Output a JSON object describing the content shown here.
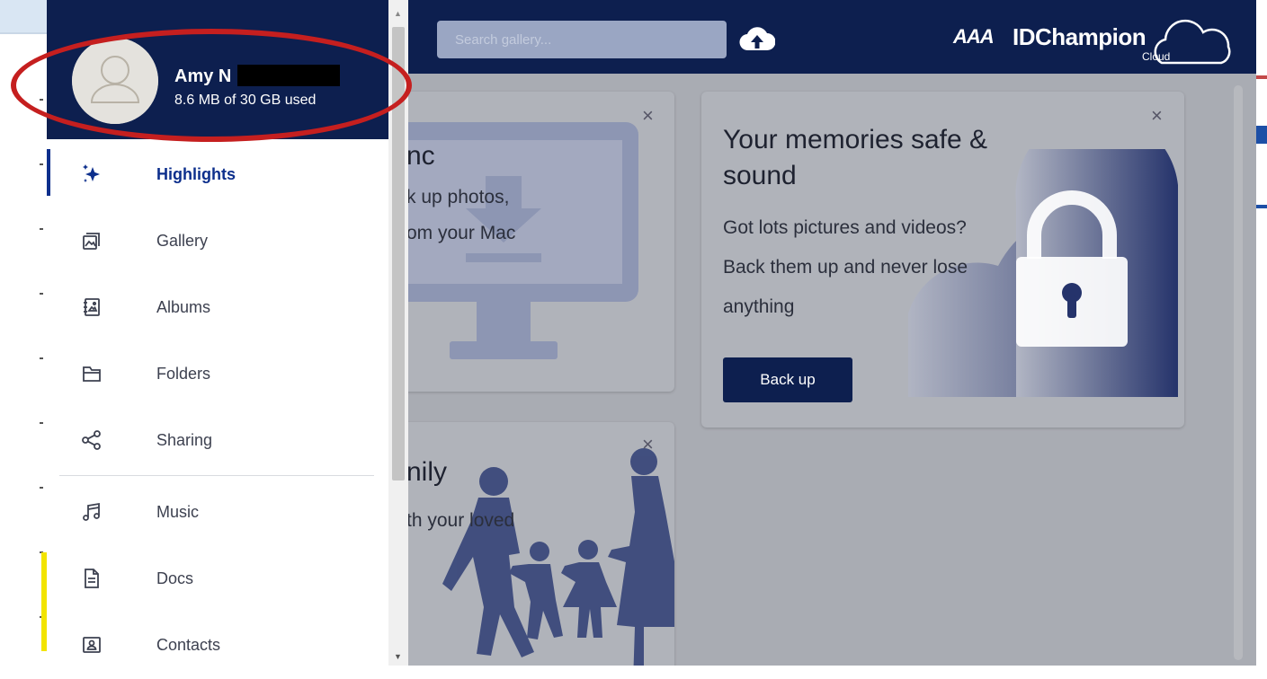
{
  "header": {
    "search_placeholder": "Search gallery...",
    "brand_mark": "AAA",
    "brand_name": "IDChampion",
    "brand_sub": "Cloud"
  },
  "user": {
    "name": "Amy N",
    "usage": "8.6 MB of 30 GB used"
  },
  "nav": {
    "items": [
      {
        "label": "Highlights",
        "icon": "sparkle-icon",
        "active": true
      },
      {
        "label": "Gallery",
        "icon": "gallery-icon"
      },
      {
        "label": "Albums",
        "icon": "album-icon"
      },
      {
        "label": "Folders",
        "icon": "folder-icon"
      },
      {
        "label": "Sharing",
        "icon": "share-icon"
      },
      {
        "label": "Music",
        "icon": "music-icon"
      },
      {
        "label": "Docs",
        "icon": "document-icon"
      },
      {
        "label": "Contacts",
        "icon": "contact-icon"
      }
    ]
  },
  "cards": {
    "sync": {
      "title": "nc",
      "line1": "k up photos,",
      "line2": "om your Mac"
    },
    "memories": {
      "title_line1": "Your memories safe &",
      "title_line2": "sound",
      "line1": "Got lots pictures and videos?",
      "line2": "Back them up and never lose",
      "line3": "anything",
      "button": "Back up"
    },
    "family": {
      "title": "nily",
      "line1": "th your loved"
    },
    "close": "×"
  },
  "colors": {
    "navy": "#0d1f4f",
    "active": "#0d2f8c",
    "highlight_ring": "#c51f1f"
  }
}
